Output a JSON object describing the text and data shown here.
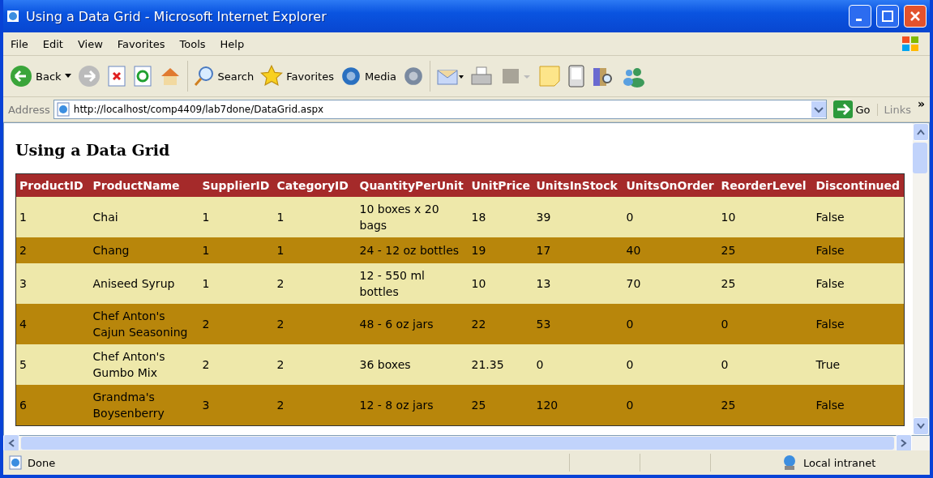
{
  "window": {
    "title": "Using a Data Grid - Microsoft Internet Explorer"
  },
  "menu": [
    "File",
    "Edit",
    "View",
    "Favorites",
    "Tools",
    "Help"
  ],
  "toolbar": {
    "back": "Back",
    "search": "Search",
    "favorites": "Favorites",
    "media": "Media"
  },
  "address": {
    "label": "Address",
    "url": "http://localhost/comp4409/lab7done/DataGrid.aspx",
    "go": "Go",
    "links": "Links",
    "more": "»"
  },
  "page": {
    "heading": "Using a Data Grid"
  },
  "table": {
    "columns": [
      "ProductID",
      "ProductName",
      "SupplierID",
      "CategoryID",
      "QuantityPerUnit",
      "UnitPrice",
      "UnitsInStock",
      "UnitsOnOrder",
      "ReorderLevel",
      "Discontinued"
    ],
    "rows": [
      [
        "1",
        "Chai",
        "1",
        "1",
        "10 boxes x 20 bags",
        "18",
        "39",
        "0",
        "10",
        "False"
      ],
      [
        "2",
        "Chang",
        "1",
        "1",
        "24 - 12 oz bottles",
        "19",
        "17",
        "40",
        "25",
        "False"
      ],
      [
        "3",
        "Aniseed Syrup",
        "1",
        "2",
        "12 - 550 ml bottles",
        "10",
        "13",
        "70",
        "25",
        "False"
      ],
      [
        "4",
        "Chef Anton's Cajun Seasoning",
        "2",
        "2",
        "48 - 6 oz jars",
        "22",
        "53",
        "0",
        "0",
        "False"
      ],
      [
        "5",
        "Chef Anton's Gumbo Mix",
        "2",
        "2",
        "36 boxes",
        "21.35",
        "0",
        "0",
        "0",
        "True"
      ],
      [
        "6",
        "Grandma's Boysenberry",
        "3",
        "2",
        "12 - 8 oz jars",
        "25",
        "120",
        "0",
        "25",
        "False"
      ]
    ]
  },
  "status_bar": {
    "text": "Done",
    "zone": "Local intranet"
  }
}
